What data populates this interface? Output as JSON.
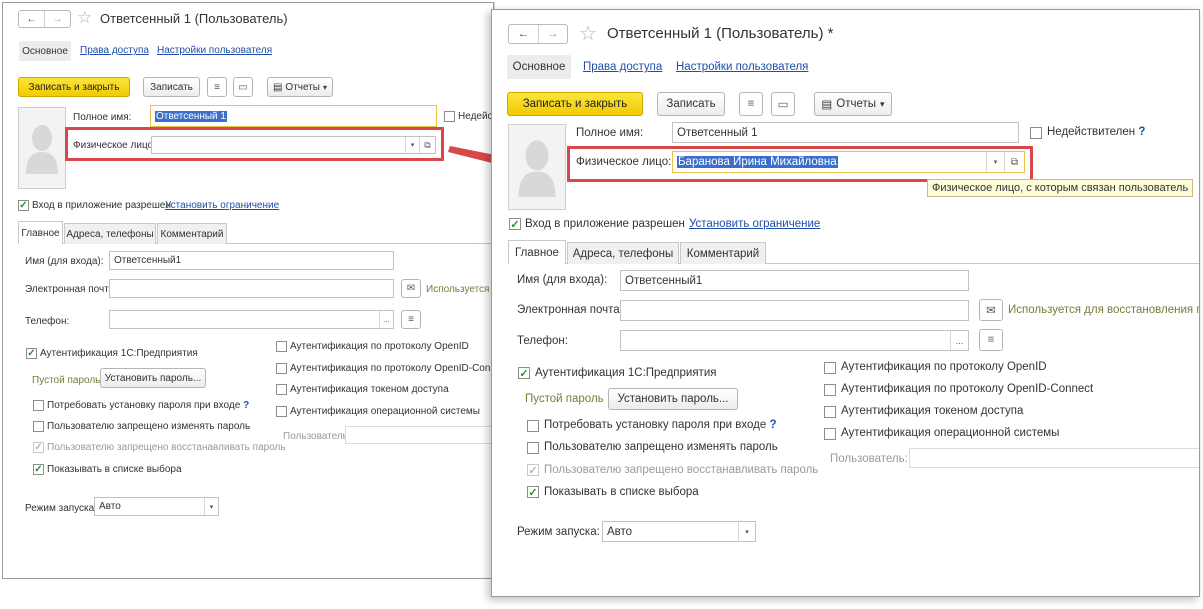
{
  "left": {
    "title": "Ответсенный 1 (Пользователь)",
    "tabs": [
      "Основное",
      "Права доступа",
      "Настройки пользователя"
    ],
    "toolbar": {
      "save_close": "Записать и закрыть",
      "save": "Записать",
      "reports": "Отчеты"
    },
    "full_name_label": "Полное имя:",
    "full_name_value": "Ответсенный 1",
    "invalid_label": "Недейст",
    "person_label": "Физическое лицо:",
    "person_value": "",
    "login_allowed": "Вход в приложение разрешен",
    "set_limit": "Установить ограничение",
    "subtabs": [
      "Главное",
      "Адреса, телефоны",
      "Комментарий"
    ],
    "login_name_label": "Имя (для входа):",
    "login_name_value": "Ответсенный1",
    "email_label": "Электронная почта:",
    "email_note": "Используется д",
    "phone_label": "Телефон:",
    "auth_1c": "Аутентификация 1С:Предприятия",
    "empty_password": "Пустой пароль",
    "set_password": "Установить пароль...",
    "require_password": "Потребовать установку пароля при входе",
    "forbid_change": "Пользователю запрещено изменять пароль",
    "forbid_restore": "Пользователю запрещено восстанавливать пароль",
    "show_in_list": "Показывать в списке выбора",
    "auth_openid": "Аутентификация по протоколу OpenID",
    "auth_openid_connect": "Аутентификация по протоколу OpenID-Connect",
    "auth_token": "Аутентификация токеном доступа",
    "auth_os": "Аутентификация операционной системы",
    "user_label": "Пользователь:",
    "launch_mode_label": "Режим запуска:",
    "launch_mode_value": "Авто"
  },
  "right": {
    "title": "Ответсенный 1 (Пользователь) *",
    "tabs": [
      "Основное",
      "Права доступа",
      "Настройки пользователя"
    ],
    "toolbar": {
      "save_close": "Записать и закрыть",
      "save": "Записать",
      "reports": "Отчеты"
    },
    "full_name_label": "Полное имя:",
    "full_name_value": "Ответсенный 1",
    "invalid_label": "Недействителен",
    "person_label": "Физическое лицо:",
    "person_value": "Баранова Ирина Михайловна",
    "tooltip": "Физическое лицо, с которым связан пользователь",
    "login_allowed": "Вход в приложение разрешен",
    "set_limit": "Установить ограничение",
    "subtabs": [
      "Главное",
      "Адреса, телефоны",
      "Комментарий"
    ],
    "login_name_label": "Имя (для входа):",
    "login_name_value": "Ответсенный1",
    "email_label": "Электронная почта:",
    "email_note": "Используется для восстановления п",
    "phone_label": "Телефон:",
    "auth_1c": "Аутентификация 1С:Предприятия",
    "empty_password": "Пустой пароль",
    "set_password": "Установить пароль...",
    "require_password": "Потребовать установку пароля при входе",
    "forbid_change": "Пользователю запрещено изменять пароль",
    "forbid_restore": "Пользователю запрещено восстанавливать пароль",
    "show_in_list": "Показывать в списке выбора",
    "auth_openid": "Аутентификация по протоколу OpenID",
    "auth_openid_connect": "Аутентификация по протоколу OpenID-Connect",
    "auth_token": "Аутентификация токеном доступа",
    "auth_os": "Аутентификация операционной системы",
    "user_label": "Пользователь:",
    "launch_mode_label": "Режим запуска:",
    "launch_mode_value": "Авто"
  },
  "icons": {
    "back": "←",
    "forward": "→",
    "star": "☆",
    "question": "?",
    "check": "✓",
    "dropdown": "▾",
    "open": "⧉",
    "ellipsis": "...",
    "avatar": "person-silhouette-icon"
  },
  "colors": {
    "accent_yellow": "#f5d20c",
    "highlight_red": "#d94848",
    "link": "#1f4ea8",
    "selection": "#3b6fcb",
    "check_green": "#2e8b2e"
  }
}
